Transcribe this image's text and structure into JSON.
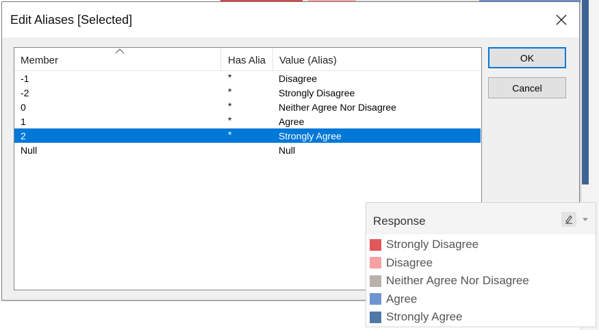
{
  "dialog": {
    "title": "Edit Aliases [Selected]",
    "columns": {
      "member": "Member",
      "has_alias": "Has Alia",
      "value": "Value (Alias)"
    },
    "rows": [
      {
        "member": "-1",
        "has_alias": "*",
        "value": "Disagree",
        "selected": false
      },
      {
        "member": "-2",
        "has_alias": "*",
        "value": "Strongly Disagree",
        "selected": false
      },
      {
        "member": "0",
        "has_alias": "*",
        "value": "Neither Agree Nor Disagree",
        "selected": false
      },
      {
        "member": "1",
        "has_alias": "*",
        "value": "Agree",
        "selected": false
      },
      {
        "member": "2",
        "has_alias": "*",
        "value": "Strongly Agree",
        "selected": true
      },
      {
        "member": "Null",
        "has_alias": "",
        "value": "Null",
        "selected": false
      }
    ],
    "ok_label": "OK",
    "cancel_label": "Cancel",
    "selection_color": "#0078d7"
  },
  "legend": {
    "title": "Response",
    "items": [
      {
        "label": "Strongly Disagree",
        "color": "#e15759"
      },
      {
        "label": "Disagree",
        "color": "#f7a1a4"
      },
      {
        "label": "Neither Agree Nor Disagree",
        "color": "#bab0ac"
      },
      {
        "label": "Agree",
        "color": "#6e95d2"
      },
      {
        "label": "Strongly Agree",
        "color": "#4e79a7"
      }
    ]
  },
  "icons": {
    "close": "close-icon",
    "sort": "sort-up-icon",
    "edit": "pencil-icon",
    "dropdown": "chevron-down-icon"
  }
}
